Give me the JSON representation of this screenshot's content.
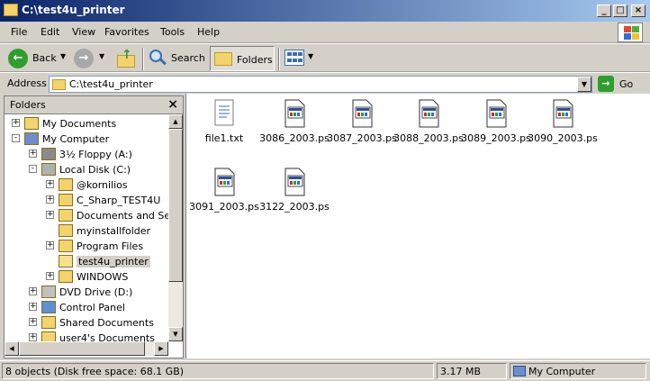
{
  "window": {
    "title": "C:\\test4u_printer",
    "buttons": [
      "minimize",
      "maximize",
      "close"
    ]
  },
  "menu": [
    "File",
    "Edit",
    "View",
    "Favorites",
    "Tools",
    "Help"
  ],
  "toolbar": {
    "back_label": "Back",
    "search_label": "Search",
    "folders_label": "Folders"
  },
  "address": {
    "label": "Address",
    "value": "C:\\test4u_printer",
    "go_label": "Go"
  },
  "folders_pane": {
    "title": "Folders",
    "tree": [
      {
        "label": "My Documents",
        "expander": "+",
        "icon": "my-documents-icon"
      },
      {
        "label": "My Computer",
        "expander": "-",
        "icon": "my-computer-icon"
      },
      {
        "label": "3½ Floppy (A:)",
        "expander": "+",
        "icon": "floppy-icon"
      },
      {
        "label": "Local Disk (C:)",
        "expander": "-",
        "icon": "hard-disk-icon"
      },
      {
        "label": "@kornilios",
        "expander": "+",
        "icon": "folder-icon"
      },
      {
        "label": "C_Sharp_TEST4U",
        "expander": "+",
        "icon": "folder-icon"
      },
      {
        "label": "Documents and Setti",
        "expander": "+",
        "icon": "folder-icon"
      },
      {
        "label": "myinstallfolder",
        "expander": "",
        "icon": "folder-icon"
      },
      {
        "label": "Program Files",
        "expander": "+",
        "icon": "folder-icon"
      },
      {
        "label": "test4u_printer",
        "expander": "",
        "icon": "folder-open-icon",
        "selected": true
      },
      {
        "label": "WINDOWS",
        "expander": "+",
        "icon": "folder-icon"
      },
      {
        "label": "DVD Drive (D:)",
        "expander": "+",
        "icon": "dvd-drive-icon"
      },
      {
        "label": "Control Panel",
        "expander": "+",
        "icon": "control-panel-icon"
      },
      {
        "label": "Shared Documents",
        "expander": "+",
        "icon": "folder-icon"
      },
      {
        "label": "user4's Documents",
        "expander": "+",
        "icon": "folder-icon"
      }
    ]
  },
  "files": [
    {
      "name": "file1.txt",
      "type": "text-file-icon"
    },
    {
      "name": "3086_2003.ps",
      "type": "ps-file-icon"
    },
    {
      "name": "3087_2003.ps",
      "type": "ps-file-icon"
    },
    {
      "name": "3088_2003.ps",
      "type": "ps-file-icon"
    },
    {
      "name": "3089_2003.ps",
      "type": "ps-file-icon"
    },
    {
      "name": "3090_2003.ps",
      "type": "ps-file-icon"
    },
    {
      "name": "3091_2003.ps",
      "type": "ps-file-icon"
    },
    {
      "name": "3122_2003.ps",
      "type": "ps-file-icon"
    }
  ],
  "status": {
    "objects": "8 objects (Disk free space: 68.1 GB)",
    "size": "3.17 MB",
    "location": "My Computer"
  }
}
